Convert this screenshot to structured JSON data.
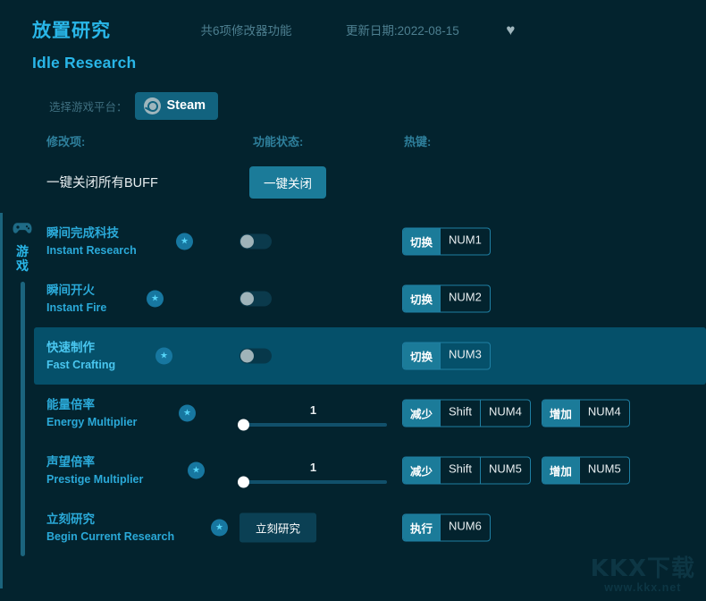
{
  "header": {
    "title_cn": "放置研究",
    "title_en": "Idle Research",
    "feature_count": "共6项修改器功能",
    "update_date": "更新日期:2022-08-15",
    "favorite_icon": "♥"
  },
  "platform": {
    "label": "选择游戏平台：",
    "selected": "Steam"
  },
  "columns": {
    "modifier": "修改项:",
    "status": "功能状态:",
    "hotkey": "热键:"
  },
  "buff": {
    "label": "一键关闭所有BUFF",
    "button": "一键关闭"
  },
  "rail": {
    "category_cn": "游戏",
    "icon": "gamepad-icon"
  },
  "rows": [
    {
      "name_cn": "瞬间完成科技",
      "name_en": "Instant Research",
      "control": "toggle",
      "toggle_on": false,
      "keys": [
        {
          "action": "切换",
          "cap": "NUM1"
        }
      ],
      "highlight": false
    },
    {
      "name_cn": "瞬间开火",
      "name_en": "Instant Fire",
      "control": "toggle",
      "toggle_on": false,
      "keys": [
        {
          "action": "切换",
          "cap": "NUM2"
        }
      ],
      "highlight": false
    },
    {
      "name_cn": "快速制作",
      "name_en": "Fast Crafting",
      "control": "toggle",
      "toggle_on": false,
      "keys": [
        {
          "action": "切换",
          "cap": "NUM3"
        }
      ],
      "highlight": true
    },
    {
      "name_cn": "能量倍率",
      "name_en": "Energy Multiplier",
      "control": "slider",
      "value": "1",
      "slider_percent": 0,
      "keys": [
        {
          "action": "减少",
          "cap": "Shift",
          "cap2": "NUM4"
        },
        {
          "action": "增加",
          "cap": "NUM4"
        }
      ],
      "highlight": false
    },
    {
      "name_cn": "声望倍率",
      "name_en": "Prestige Multiplier",
      "control": "slider",
      "value": "1",
      "slider_percent": 0,
      "keys": [
        {
          "action": "减少",
          "cap": "Shift",
          "cap2": "NUM5"
        },
        {
          "action": "增加",
          "cap": "NUM5"
        }
      ],
      "highlight": false
    },
    {
      "name_cn": "立刻研究",
      "name_en": "Begin Current Research",
      "control": "button",
      "button_label": "立刻研究",
      "keys": [
        {
          "action": "执行",
          "cap": "NUM6"
        }
      ],
      "highlight": false
    }
  ],
  "watermark": {
    "main": "KKX下载",
    "sub": "www.kkx.net"
  },
  "colors": {
    "background": "#03232e",
    "accent": "#29b6e8",
    "highlight_row": "#05506a",
    "button": "#1b7b99"
  }
}
